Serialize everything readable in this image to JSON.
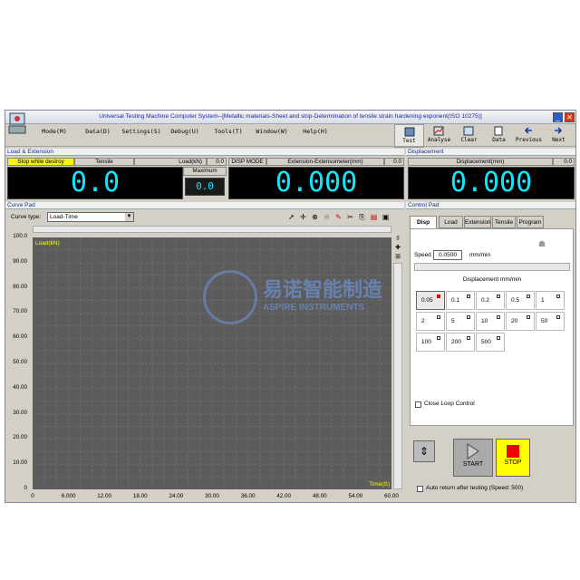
{
  "window": {
    "title": "Universal Testing Machine Computer System--[Metallic materials-Sheet and strip-Determination of tensile strain hardening exponent(ISO 10275)]"
  },
  "menu": [
    "Mode(M)",
    "Data(D)",
    "Settings(S)",
    "Debug(U)",
    "Tools(T)",
    "Window(W)",
    "Help(H)"
  ],
  "toolbar": [
    "Test",
    "Analyse",
    "Clear",
    "Data",
    "Previous",
    "Next"
  ],
  "load_ext": {
    "header": "Load & Extension",
    "stop_label": "Stop while destroy",
    "tensile_label": "Tensile",
    "load_label": "Load(kN)",
    "load_small": "0.0",
    "load_value": "0.0",
    "maximum_label": "Maximum",
    "maximum_value": "0.0",
    "disp_mode": "DISP MODE",
    "ext_label": "Extension-Extensometer(mm)",
    "ext_small": "0.0",
    "ext_value": "0.000"
  },
  "displacement": {
    "header": "Displacement",
    "label": "Displacement(mm)",
    "small": "0.0",
    "value": "0.000"
  },
  "curve": {
    "header": "Curve Pad",
    "type_label": "Curve type:",
    "type_value": "Load-Time",
    "y_title": "Load(kN)",
    "x_title": "Time(S)",
    "y_ticks": [
      "100.0",
      "90.00",
      "80.00",
      "70.00",
      "60.00",
      "50.00",
      "40.00",
      "30.00",
      "20.00",
      "10.00",
      "0"
    ],
    "x_ticks": [
      "0",
      "6.000",
      "12.00",
      "18.00",
      "24.00",
      "30.00",
      "36.00",
      "42.00",
      "48.00",
      "54.00",
      "60.00"
    ],
    "watermark_text": "易诺智能制造",
    "watermark_sub": "ASPIRE INSTRUMENTS"
  },
  "control": {
    "header": "Control Pad",
    "tabs": [
      "Disp",
      "Load",
      "Extension",
      "Tensile",
      "Program"
    ],
    "speed_label": "Speed",
    "speed_value": "0.0500",
    "speed_unit": "mm/min",
    "disp_header": "Displacement mm/min",
    "speeds": [
      "0.05",
      "0.1",
      "0.2",
      "0.5",
      "1",
      "2",
      "5",
      "10",
      "20",
      "50",
      "100",
      "200",
      "500"
    ],
    "close_loop": "Close Loop Control",
    "start": "START",
    "stop": "STOP",
    "auto_return": "Auto return after testing (Speed: 500)"
  }
}
